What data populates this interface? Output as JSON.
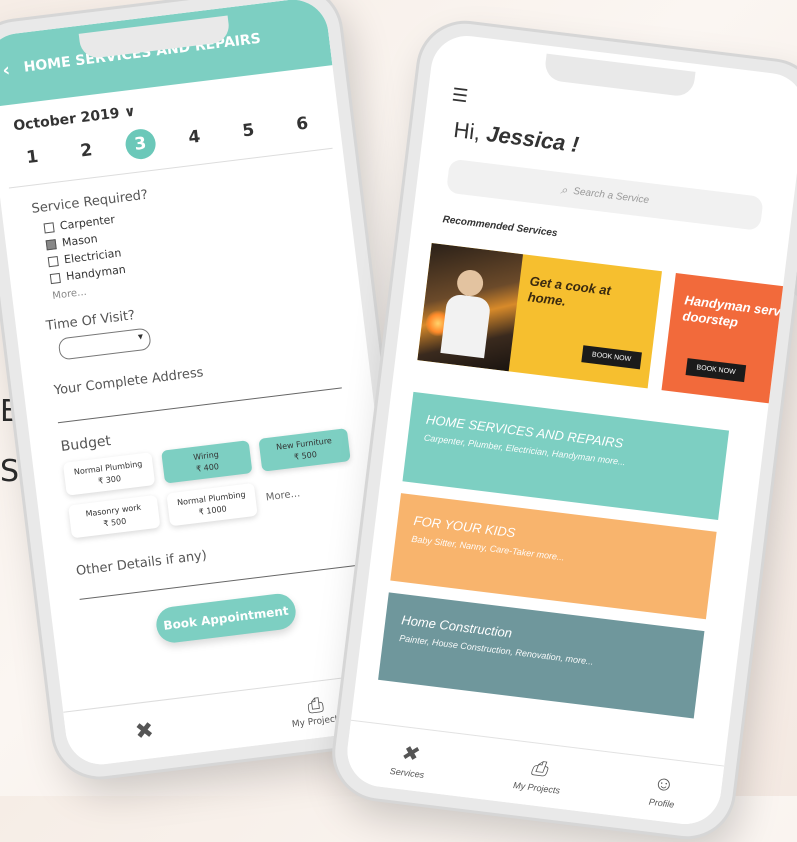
{
  "background_text": [
    "ED",
    "S"
  ],
  "left_phone": {
    "header_title": "HOME SERVICES AND REPAIRS",
    "month_label": "October 2019 ∨",
    "dates": [
      "1",
      "2",
      "3",
      "4",
      "5",
      "6"
    ],
    "selected_date": "3",
    "service_section": "Service Required?",
    "services": [
      {
        "label": "Carpenter",
        "checked": false
      },
      {
        "label": "Mason",
        "checked": true
      },
      {
        "label": "Electrician",
        "checked": false
      },
      {
        "label": "Handyman",
        "checked": false
      }
    ],
    "services_more": "More...",
    "time_label": "Time Of Visit?",
    "address_label": "Your Complete Address",
    "budget_label": "Budget",
    "budget_options": [
      {
        "title": "Normal Plumbing",
        "price": "₹ 300"
      },
      {
        "title": "Wiring",
        "price": "₹ 400"
      },
      {
        "title": "New Furniture",
        "price": "₹ 500"
      },
      {
        "title": "Masonry work",
        "price": "₹ 500"
      },
      {
        "title": "Normal Plumbing",
        "price": "₹ 1000"
      },
      {
        "title": "More...",
        "price": ""
      }
    ],
    "other_label": "Other Details if any)",
    "book_button": "Book Appointment",
    "nav": [
      "",
      "My Projects"
    ]
  },
  "right_phone": {
    "greeting_prefix": "Hi, ",
    "greeting_name": "Jessica !",
    "search_placeholder": "Search a Service",
    "recommended_title": "Recommended Services",
    "promo1_text": "Get a cook at home.",
    "promo1_button": "BOOK NOW",
    "promo2_text": "Handyman services at your doorstep",
    "promo2_button": "BOOK NOW",
    "categories": [
      {
        "title": "HOME SERVICES AND REPAIRS",
        "desc": "Carpenter, Plumber, Electrician, Handyman more..."
      },
      {
        "title": "FOR YOUR KIDS",
        "desc": "Baby Sitter, Nanny, Care-Taker more..."
      },
      {
        "title": "Home Construction",
        "desc": "Painter, House Construction, Renovation, more..."
      }
    ],
    "nav": [
      "Services",
      "My Projects",
      "Profile"
    ]
  },
  "colors": {
    "teal": "#7dcfc2",
    "yellow": "#f6bf2f",
    "orange": "#f26a3b",
    "peach": "#f8b46d",
    "slate": "#6f979c"
  },
  "icons": [
    "back-arrow-icon",
    "menu-icon",
    "search-icon",
    "tools-icon",
    "projects-icon",
    "profile-icon"
  ]
}
